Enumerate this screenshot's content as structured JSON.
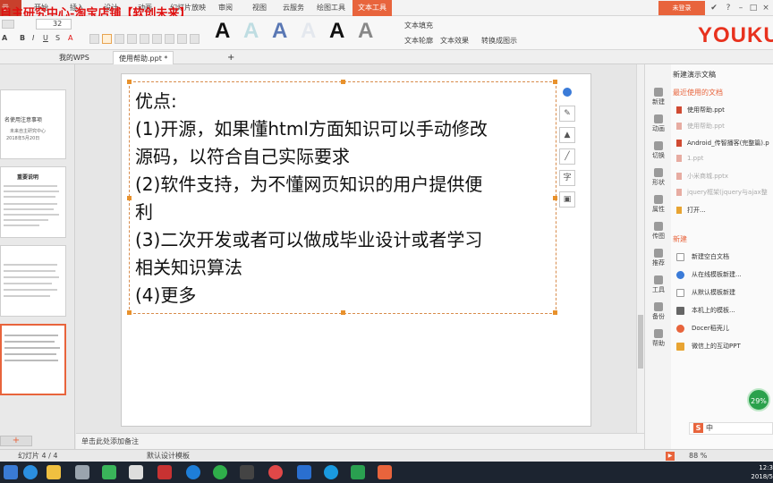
{
  "app": {
    "menu_label": "示",
    "watermark": "自主研究中心-淘宝店铺【软创未来】",
    "tabs": [
      "开始",
      "插入",
      "设计",
      "动画",
      "幻灯片放映",
      "审阅",
      "视图",
      "云服务",
      "绘图工具",
      "文本工具"
    ],
    "active_tab": "文本工具",
    "login": "未登录"
  },
  "ribbon": {
    "font_size": "32",
    "text_fill": "文本填充",
    "text_outline": "文本轮廓",
    "text_effect": "文本效果",
    "convert_graphic": "转换成图示",
    "art_letter": "A",
    "logo": "YOUKU"
  },
  "doc_tabs": [
    {
      "label": "我的WPS",
      "active": false
    },
    {
      "label": "使用帮助.ppt *",
      "active": true
    }
  ],
  "thumbnails": [
    {
      "title": "名使用注意事项",
      "sub": "未来自主研究中心",
      "date": "2018年5月20日"
    },
    {
      "title": "重要说明"
    },
    {},
    {
      "title": "",
      "selected": true
    }
  ],
  "slide": {
    "lines": [
      "优点:",
      "(1)开源，如果懂html方面知识可以手动修改",
      "源码，以符合自己实际要求",
      "(2)软件支持，为不懂网页知识的用户提供便",
      "利",
      "(3)二次开发或者可以做成毕业设计或者学习",
      "相关知识算法",
      "(4)更多"
    ]
  },
  "notes_placeholder": "单击此处添加备注",
  "sidebar": [
    "新建",
    "动画",
    "切换",
    "形状",
    "属性",
    "传图",
    "推荐",
    "工具",
    "备份",
    "帮助"
  ],
  "taskpane": {
    "new_ppt": "新建演示文稿",
    "recent_header": "最近使用的文档",
    "recent": [
      {
        "name": "使用帮助.ppt",
        "dim": false
      },
      {
        "name": "使用帮助.ppt",
        "dim": true
      },
      {
        "name": "Android_传智播客(完整篇).p",
        "dim": false
      },
      {
        "name": "1.ppt",
        "dim": true
      },
      {
        "name": "小米商城.pptx",
        "dim": true
      },
      {
        "name": "jquery框架(jquery与ajax整",
        "dim": true
      }
    ],
    "open": "打开...",
    "new_header": "新建",
    "new_items": [
      "新建空白文档",
      "从在线模板新建...",
      "从默认模板新建",
      "本机上的模板...",
      "Docer稻壳儿",
      "微信上的互动PPT"
    ]
  },
  "progress_badge": "29%",
  "ime": "中",
  "status": {
    "slide_info": "幻灯片 4 / 4",
    "template": "默认设计模板",
    "zoom": "88 %"
  },
  "clock": {
    "time": "12:3",
    "date": "2018/5"
  },
  "colors": {
    "accent": "#e8643c",
    "watermark": "#e01010",
    "youku": "#e8321e",
    "taskbar": "#1c2430"
  }
}
